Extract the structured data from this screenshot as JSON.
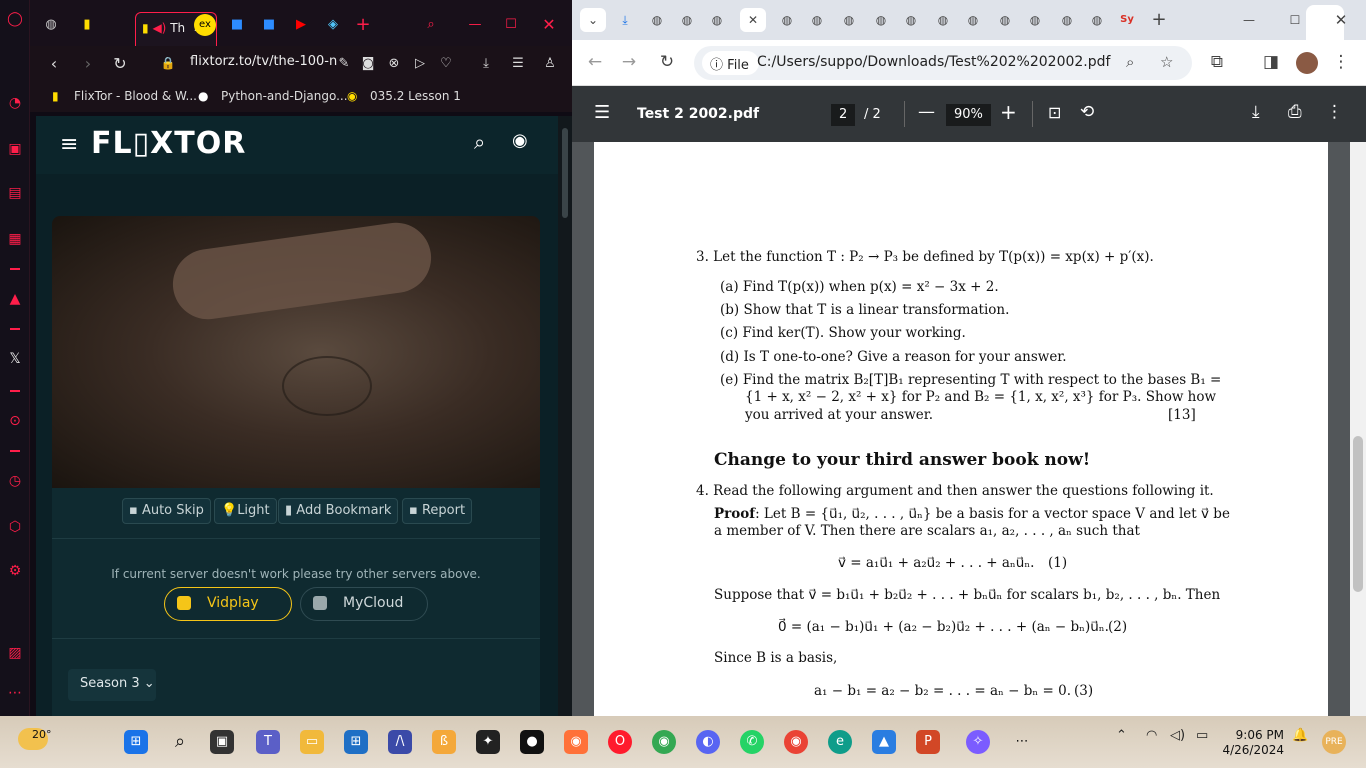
{
  "opera": {
    "active_tab_label": "Th",
    "url": "flixtorz.to/tv/the-100-n",
    "bookmarks": [
      "FlixTor - Blood & W...",
      "Python-and-Django...",
      "035.2 Lesson 1"
    ]
  },
  "site": {
    "logo": "FL▯XTOR",
    "controls": {
      "auto_skip": "Auto Skip",
      "light": "Light",
      "add_bookmark": "Add Bookmark",
      "report": "Report"
    },
    "server_hint": "If current server doesn't work please try other servers above.",
    "servers": [
      "Vidplay",
      "MyCloud"
    ],
    "season": "Season 3"
  },
  "chrome": {
    "file_chip": "File",
    "url": "C:/Users/suppo/Downloads/Test%202%202002.pdf",
    "pdf": {
      "title": "Test 2 2002.pdf",
      "page_current": "2",
      "page_total": "/ 2",
      "zoom": "90%"
    }
  },
  "document": {
    "q3": "3.  Let the function T : P₂ → P₃ be defined by T(p(x)) = xp(x) + p′(x).",
    "q3a": "(a)  Find T(p(x)) when p(x) = x² − 3x + 2.",
    "q3b": "(b)  Show that T is a linear transformation.",
    "q3c": "(c)  Find ker(T). Show your working.",
    "q3d": "(d)  Is T one-to-one? Give a reason for your answer.",
    "q3e1": "(e)  Find the matrix B₂[T]B₁ representing T with respect to the bases B₁ =",
    "q3e2": "{1 + x, x² − 2, x² + x} for P₂ and B₂ = {1, x, x², x³} for P₃. Show how",
    "q3e3": "you arrived at your answer.",
    "q3marks": "[13]",
    "change": "Change to your third answer book now!",
    "q4": "4.  Read the following argument and then answer the questions following it.",
    "proof1_bold": "Proof",
    "proof1": ": Let B = {u⃗₁, u⃗₂, . . . , u⃗ₙ} be a basis for a vector space V and let v⃗ be",
    "proof2": "a member of V. Then there are scalars a₁, a₂, . . . , aₙ such that",
    "eq1": "v⃗ = a₁u⃗₁ + a₂u⃗₂ + . . . + aₙu⃗ₙ.",
    "eq1n": "(1)",
    "suppose": "Suppose that v⃗ = b₁u⃗₁ + b₂u⃗₂ + . . . + bₙu⃗ₙ for scalars b₁, b₂, . . . , bₙ. Then",
    "eq2": "0⃗ = (a₁ − b₁)u⃗₁ + (a₂ − b₂)u⃗₂ + . . . + (aₙ − bₙ)u⃗ₙ.",
    "eq2n": "(2)",
    "since": "Since B is a basis,",
    "eq3": "a₁ − b₁ = a₂ − b₂ = . . . = aₙ − bₙ = 0.",
    "eq3n": "(3)"
  },
  "taskbar": {
    "weather": "20°",
    "time": "9:06 PM",
    "date": "4/26/2024"
  }
}
